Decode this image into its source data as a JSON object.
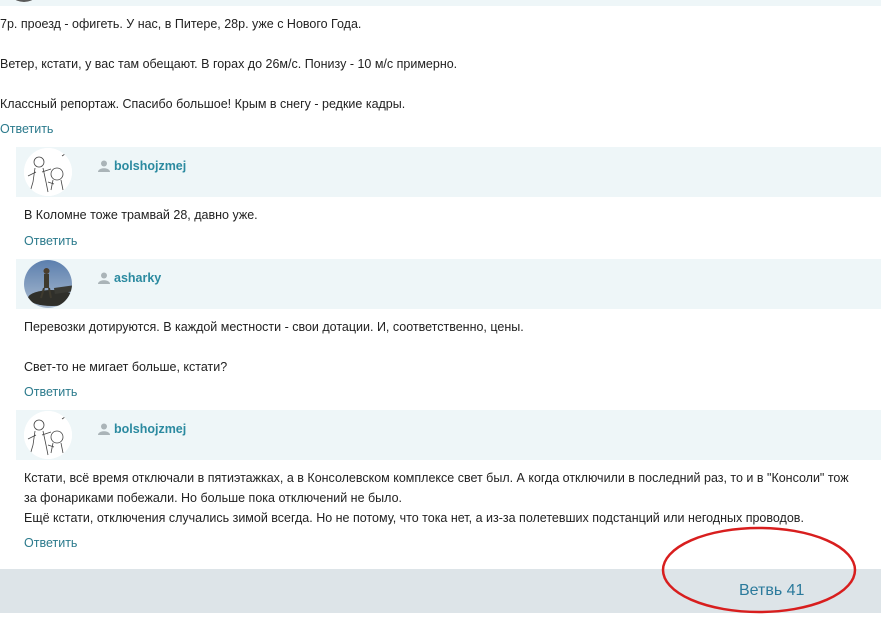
{
  "top_comment": {
    "lines": [
      "7р. проезд - офигеть. У нас, в Питере, 28р. уже с Нового Года.",
      "Ветер, кстати, у вас там обещают. В горах до 26м/с. Понизу - 10 м/с примерно.",
      "Классный репортаж. Спасибо большое! Крым в снегу - редкие кадры."
    ],
    "reply_label": "Ответить"
  },
  "comments": [
    {
      "username": "bolshojzmej",
      "lines": [
        "В Коломне тоже трамвай 28, давно уже."
      ],
      "reply_label": "Ответить"
    },
    {
      "username": "asharky",
      "lines": [
        "Перевозки дотируются. В каждой местности - свои дотации. И, соответственно, цены.",
        "Свет-то не мигает больше, кстати?"
      ],
      "reply_label": "Ответить"
    },
    {
      "username": "bolshojzmej",
      "lines": [
        "Кстати, всё время отключали в пятиэтажках, а в Консолевском комплексе свет был. А когда отключили в последний раз, то и в \"Консоли\" тож",
        "за фонариками побежали. Но больше пока отключений не было.",
        "Ещё кстати, отключения случались зимой всегда. Но не потому, что тока нет, а из-за полетевших подстанций или негодных проводов."
      ],
      "reply_label": "Ответить"
    }
  ],
  "footer": {
    "branch_label": "Ветвь 41"
  },
  "colors": {
    "link": "#2b7a8c",
    "username": "#2b8aa0",
    "header_bg": "#eef6f8",
    "footer_bg": "#dde4e8",
    "annotation": "#d81e1e"
  }
}
